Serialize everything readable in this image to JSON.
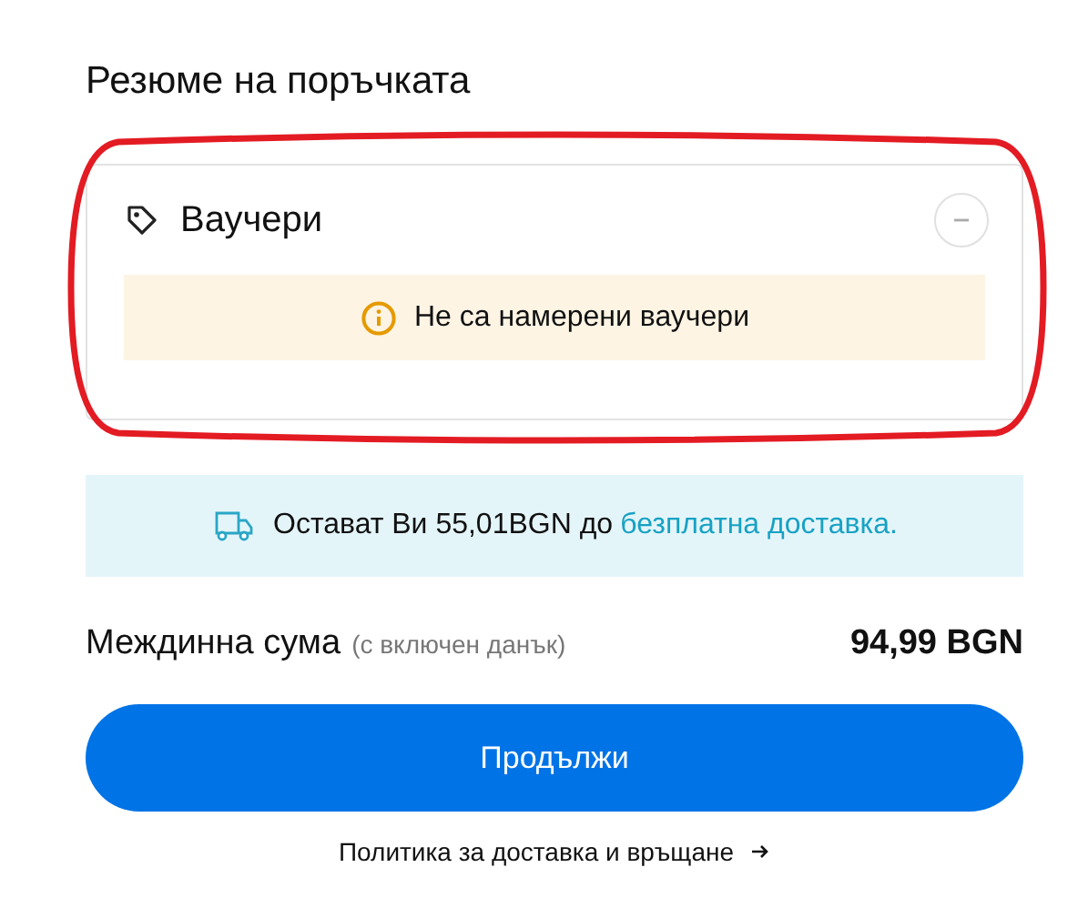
{
  "title": "Резюме на поръчката",
  "vouchers": {
    "title": "Ваучери",
    "expanded": true,
    "notice": "Не са намерени ваучери"
  },
  "shipping": {
    "text": "Остават Ви 55,01BGN до",
    "link": "безплатна доставка."
  },
  "subtotal": {
    "label": "Междинна сума",
    "note": "(с включен данък)",
    "value": "94,99 BGN"
  },
  "button": "Продължи",
  "policy_link": "Политика за доставка и връщане"
}
